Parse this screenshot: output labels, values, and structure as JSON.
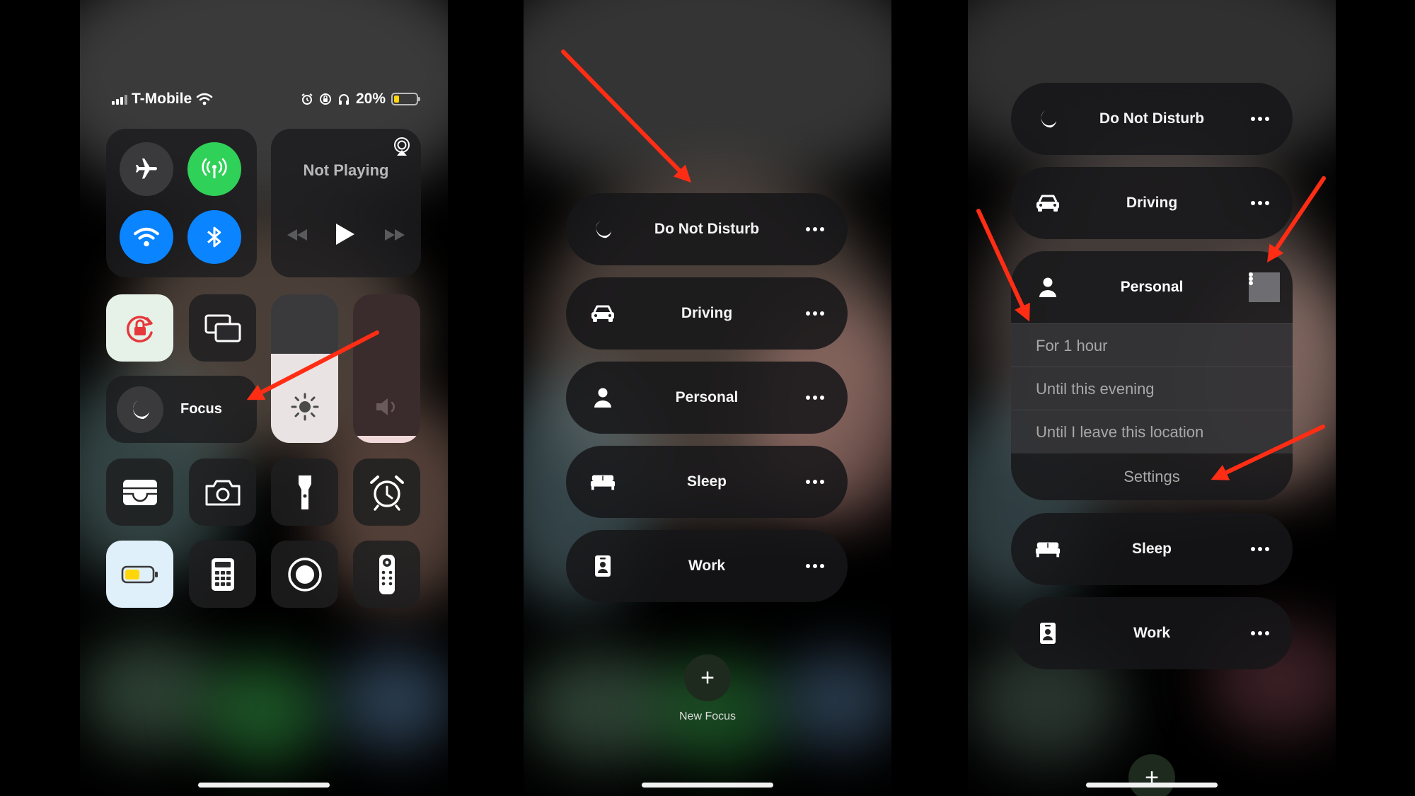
{
  "status_bar": {
    "carrier": "T-Mobile",
    "battery_text": "20%"
  },
  "control_center": {
    "now_playing": "Not Playing",
    "focus_label": "Focus",
    "icons": [
      "airplane-icon",
      "cellular-icon",
      "wifi-icon",
      "bluetooth-icon",
      "airplay-icon",
      "rewind-icon",
      "play-icon",
      "fast-forward-icon",
      "orientation-lock-icon",
      "screen-mirroring-icon",
      "moon-icon",
      "brightness-icon",
      "volume-icon",
      "wallet-icon",
      "camera-icon",
      "flashlight-icon",
      "alarm-icon",
      "low-power-icon",
      "calculator-icon",
      "screen-record-icon",
      "remote-icon"
    ],
    "brightness_level": 0.6,
    "volume_level": 0.05
  },
  "focus_menu": {
    "items": [
      {
        "label": "Do Not Disturb",
        "icon": "moon-icon"
      },
      {
        "label": "Driving",
        "icon": "car-icon"
      },
      {
        "label": "Personal",
        "icon": "person-icon"
      },
      {
        "label": "Sleep",
        "icon": "bed-icon"
      },
      {
        "label": "Work",
        "icon": "badge-icon"
      }
    ],
    "new_focus_label": "New Focus",
    "new_focus_symbol": "+"
  },
  "personal_options": {
    "options": [
      "For 1 hour",
      "Until this evening",
      "Until I leave this location"
    ],
    "settings_label": "Settings"
  },
  "colors": {
    "accent_green": "#30d158",
    "accent_blue": "#0a84ff",
    "arrow_red": "#ff2d14",
    "battery_yellow": "#ffd60a"
  }
}
